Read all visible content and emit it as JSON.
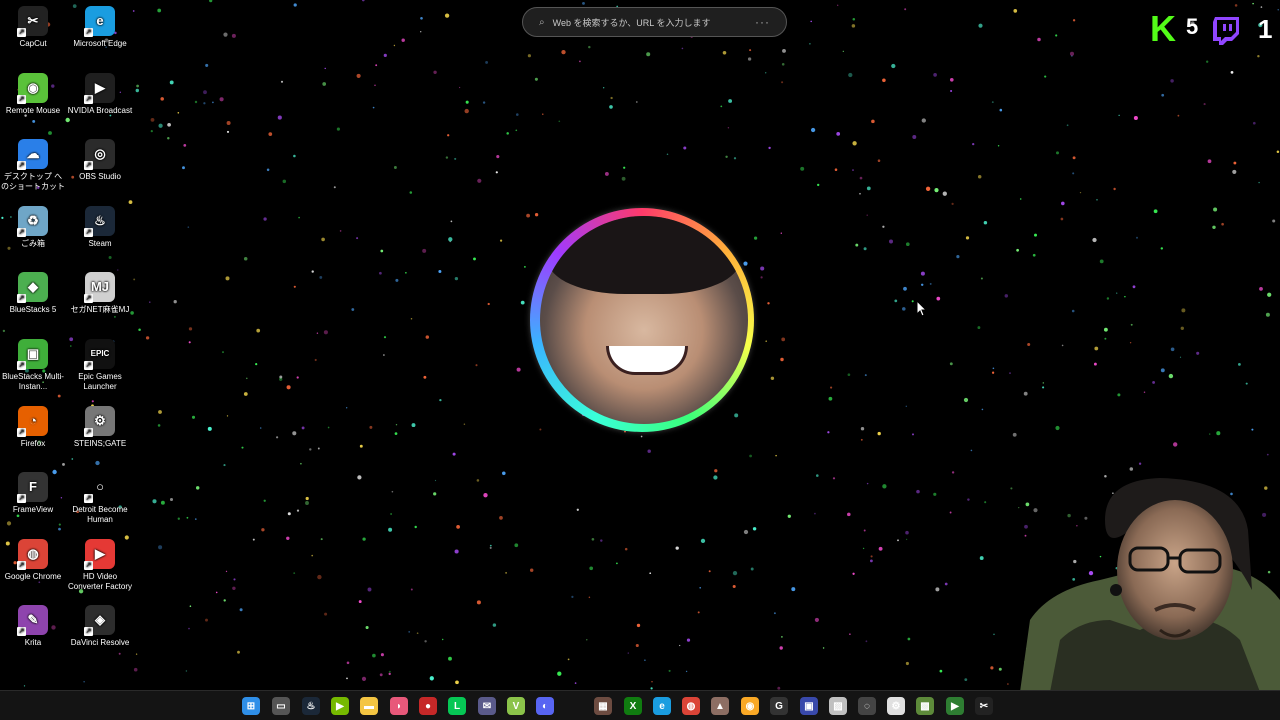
{
  "desktop": {
    "icons": [
      {
        "label": "CapCut",
        "icon": "capcut-icon",
        "color": "#222222",
        "glyph": "✂"
      },
      {
        "label": "Microsoft Edge",
        "icon": "edge-icon",
        "color": "#1a9de0",
        "glyph": "e"
      },
      {
        "label": "Remote Mouse",
        "icon": "remote-mouse-icon",
        "color": "#5ac23a",
        "glyph": "◉"
      },
      {
        "label": "NVIDIA Broadcast",
        "icon": "nvidia-broadcast-icon",
        "color": "#1f1f1f",
        "glyph": "▶"
      },
      {
        "label": "デスクトップ へのショートカット (OneDri...",
        "icon": "onedrive-icon",
        "color": "#2a7fe8",
        "glyph": "☁"
      },
      {
        "label": "OBS Studio",
        "icon": "obs-icon",
        "color": "#2b2b2b",
        "glyph": "◎"
      },
      {
        "label": "ごみ箱",
        "icon": "recycle-bin-icon",
        "color": "#6fa6c7",
        "glyph": "♻"
      },
      {
        "label": "Steam",
        "icon": "steam-icon",
        "color": "#1b2838",
        "glyph": "♨"
      },
      {
        "label": "BlueStacks 5",
        "icon": "bluestacks-icon",
        "color": "#4caf50",
        "glyph": "◆"
      },
      {
        "label": "セガNET麻雀MJ",
        "icon": "sega-mj-icon",
        "color": "#d0d0d0",
        "glyph": "MJ"
      },
      {
        "label": "BlueStacks Multi-Instan...",
        "icon": "bluestacks-multi-icon",
        "color": "#3fae3a",
        "glyph": "▣"
      },
      {
        "label": "Epic Games Launcher",
        "icon": "epic-games-icon",
        "color": "#111111",
        "glyph": "EPIC"
      },
      {
        "label": "Firefox",
        "icon": "firefox-icon",
        "color": "#e66000",
        "glyph": "◔"
      },
      {
        "label": "STEINS;GATE",
        "icon": "steins-gate-icon",
        "color": "#777777",
        "glyph": "⚙"
      },
      {
        "label": "FrameView",
        "icon": "frameview-icon",
        "color": "#333333",
        "glyph": "F"
      },
      {
        "label": "Detroit Become Human",
        "icon": "detroit-icon",
        "color": "#000000",
        "glyph": "○"
      },
      {
        "label": "Google Chrome",
        "icon": "chrome-icon",
        "color": "#db4437",
        "glyph": "◍"
      },
      {
        "label": "HD Video Converter Factory",
        "icon": "hd-video-converter-icon",
        "color": "#e53935",
        "glyph": "▶"
      },
      {
        "label": "Krita",
        "icon": "krita-icon",
        "color": "#8e44ad",
        "glyph": "✎"
      },
      {
        "label": "DaVinci Resolve",
        "icon": "davinci-resolve-icon",
        "color": "#2d2d2d",
        "glyph": "◈"
      }
    ]
  },
  "search": {
    "placeholder": "Web を検索するか、URL を入力します"
  },
  "overlay": {
    "kick_count": "5",
    "twitch_count": "1",
    "kick_color": "#53fc18",
    "twitch_color": "#9146ff"
  },
  "taskbar": {
    "icons": [
      {
        "name": "start-icon",
        "color": "#2f8fe8",
        "glyph": "⊞"
      },
      {
        "name": "task-view-icon",
        "color": "#555555",
        "glyph": "▭"
      },
      {
        "name": "steam-taskbar-icon",
        "color": "#1b2838",
        "glyph": "♨"
      },
      {
        "name": "nvidia-taskbar-icon",
        "color": "#76b900",
        "glyph": "▶"
      },
      {
        "name": "file-explorer-icon",
        "color": "#f4c542",
        "glyph": "▬"
      },
      {
        "name": "lips-app-icon",
        "color": "#e8587a",
        "glyph": "◗"
      },
      {
        "name": "record-icon",
        "color": "#c62828",
        "glyph": "●"
      },
      {
        "name": "line-icon",
        "color": "#06c755",
        "glyph": "L"
      },
      {
        "name": "chat-app-icon",
        "color": "#5a5a8a",
        "glyph": "✉"
      },
      {
        "name": "vim-app-icon",
        "color": "#8bc34a",
        "glyph": "V"
      },
      {
        "name": "discord-icon",
        "color": "#5865f2",
        "glyph": "◐"
      },
      {
        "name": "app-icon-12",
        "color": "#6d4c41",
        "glyph": "▦"
      },
      {
        "name": "xbox-icon",
        "color": "#107c10",
        "glyph": "X"
      },
      {
        "name": "edge-taskbar-icon",
        "color": "#1a9de0",
        "glyph": "e"
      },
      {
        "name": "chrome-taskbar-icon",
        "color": "#db4437",
        "glyph": "◍"
      },
      {
        "name": "game-app-icon",
        "color": "#8d6e63",
        "glyph": "▲"
      },
      {
        "name": "coin-app-icon",
        "color": "#f9a825",
        "glyph": "◉"
      },
      {
        "name": "g-app-icon",
        "color": "#333333",
        "glyph": "G"
      },
      {
        "name": "calendar-app-icon",
        "color": "#3949ab",
        "glyph": "▣"
      },
      {
        "name": "photo-app-icon",
        "color": "#c0c0c0",
        "glyph": "▨"
      },
      {
        "name": "ghost-app-icon",
        "color": "#444444",
        "glyph": "◌"
      },
      {
        "name": "tool-app-icon",
        "color": "#e0e0e0",
        "glyph": "⚙"
      },
      {
        "name": "minecraft-icon",
        "color": "#5d8a3a",
        "glyph": "▩"
      },
      {
        "name": "sheet-app-icon",
        "color": "#2e7d32",
        "glyph": "▶"
      },
      {
        "name": "capcut-taskbar-icon",
        "color": "#222222",
        "glyph": "✂"
      }
    ]
  }
}
